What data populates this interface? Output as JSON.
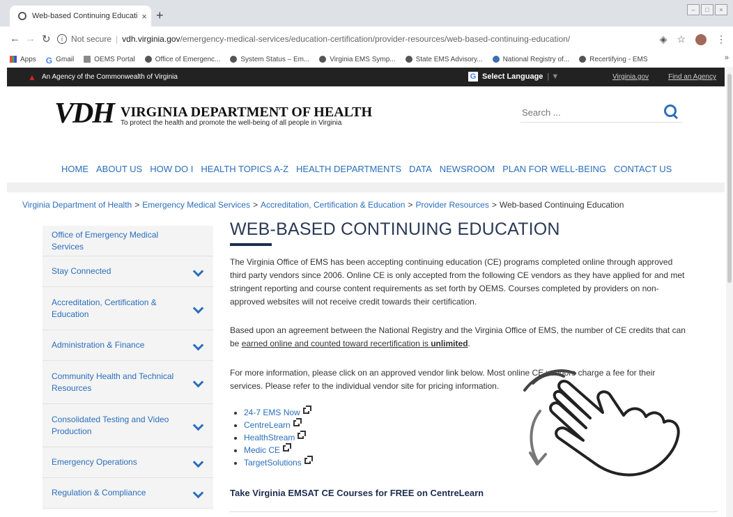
{
  "browser": {
    "tab_title": "Web-based Continuing Educatio",
    "new_tab": "+",
    "close_tab": "×",
    "url_security": "Not secure",
    "url_host": "vdh.virginia.gov",
    "url_path": "/emergency-medical-services/education-certification/provider-resources/web-based-continuing-education/",
    "bookmarks": [
      "Apps",
      "Gmail",
      "OEMS Portal",
      "Office of Emergenc...",
      "System Status – Em...",
      "Virginia EMS Symp...",
      "State EMS Advisory...",
      "National Registry of...",
      "Recertifying - EMS"
    ],
    "bookmarks_more": "»"
  },
  "agency_bar": {
    "text": "An Agency of the Commonwealth of Virginia",
    "language": "Select Language",
    "links": [
      "Virginia.gov",
      "Find an Agency"
    ]
  },
  "header": {
    "logo_mark": "VDH",
    "logo_title": "VIRGINIA DEPARTMENT OF HEALTH",
    "logo_tagline": "To protect the health and promote the well-being of all people in Virginia",
    "search_placeholder": "Search ..."
  },
  "main_nav": [
    "HOME",
    "ABOUT US",
    "HOW DO I",
    "HEALTH TOPICS A-Z",
    "HEALTH DEPARTMENTS",
    "DATA",
    "NEWSROOM",
    "PLAN FOR WELL-BEING",
    "CONTACT US"
  ],
  "breadcrumb": {
    "links": [
      "Virginia Department of Health",
      "Emergency Medical Services",
      "Accreditation, Certification & Education",
      "Provider Resources"
    ],
    "current": "Web-based Continuing Education",
    "sep": ">"
  },
  "sidebar": [
    {
      "label": "Office of Emergency Medical Services",
      "chevron": false
    },
    {
      "label": "Stay Connected",
      "chevron": true
    },
    {
      "label": "Accreditation, Certification & Education",
      "chevron": true
    },
    {
      "label": "Administration & Finance",
      "chevron": true
    },
    {
      "label": "Community Health and Technical Resources",
      "chevron": true
    },
    {
      "label": "Consolidated Testing and Video Production",
      "chevron": true
    },
    {
      "label": "Emergency Operations",
      "chevron": true
    },
    {
      "label": "Regulation & Compliance",
      "chevron": true
    }
  ],
  "content": {
    "title": "WEB-BASED CONTINUING EDUCATION",
    "p1": "The Virginia Office of EMS has been accepting continuing education (CE) programs completed online through approved third party vendors since 2006.  Online CE is only accepted from the following CE vendors as they have applied for and met stringent reporting and course content requirements as set forth by OEMS. Courses completed by providers on non-approved websites will not receive credit towards their certification.",
    "p2_a": "Based upon an agreement between the National Registry and the Virginia Office of EMS, the number of CE credits that can be ",
    "p2_link": "earned online and counted toward recertification is ",
    "p2_bold": "unlimited",
    "p2_end": ".",
    "p3": "For more information, please click on an approved vendor link below.  Most online CE vendors charge a fee for their services.  Please refer to the individual vendor site for pricing information.",
    "vendors": [
      "24-7 EMS Now",
      "CentreLearn",
      "HealthStream",
      "Medic CE",
      "TargetSolutions"
    ],
    "subheading": "Take Virginia EMSAT CE Courses for FREE on CentreLearn"
  }
}
